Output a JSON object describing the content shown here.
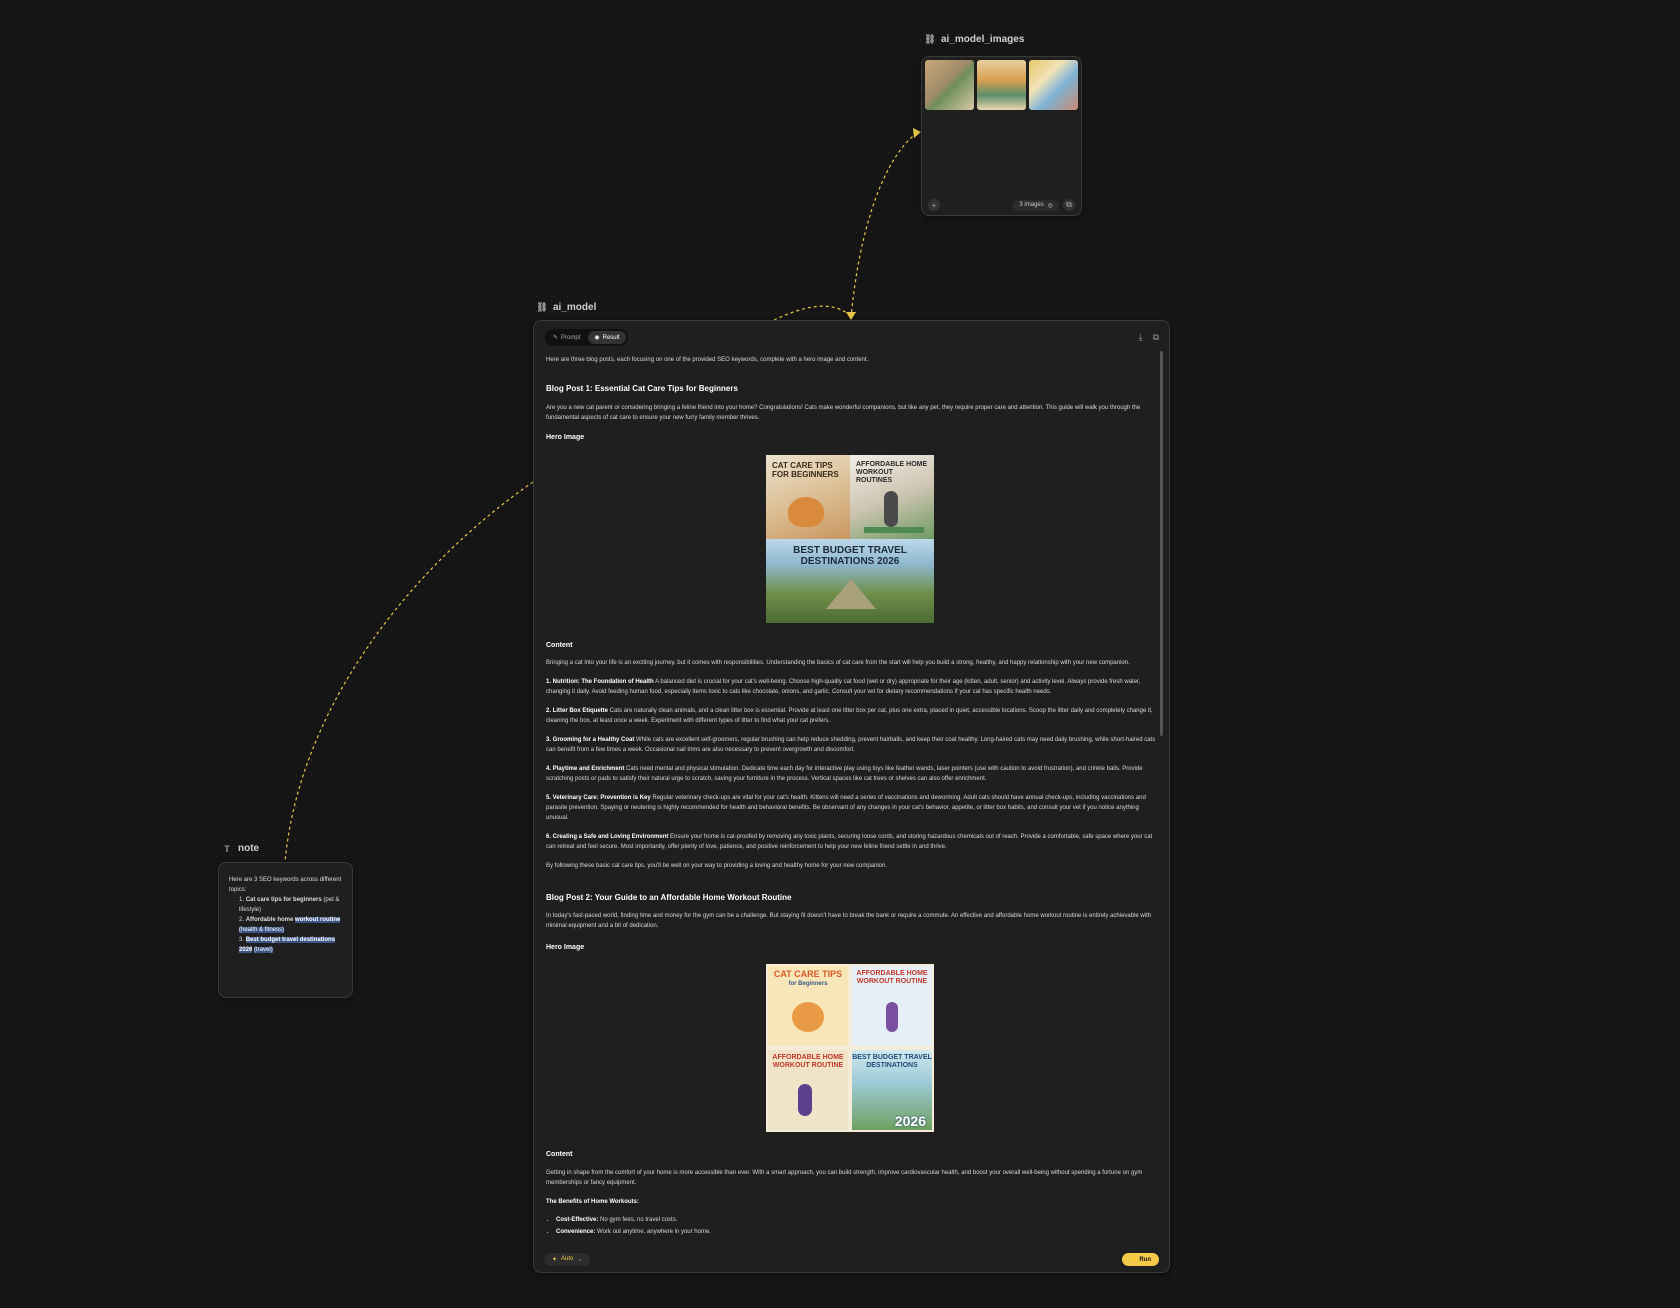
{
  "images_node": {
    "label": "ai_model_images",
    "count_label": "3 images",
    "thumbs": [
      {
        "name": "thumb-1",
        "colors": [
          "#c9a87a",
          "#6f8f5a",
          "#d9c7a8"
        ]
      },
      {
        "name": "thumb-2",
        "colors": [
          "#d9a050",
          "#5d8e6a",
          "#e9d6b0"
        ]
      },
      {
        "name": "thumb-3",
        "colors": [
          "#e8c86a",
          "#7db3d6",
          "#c98b6e"
        ]
      }
    ]
  },
  "main_node": {
    "label": "ai_model",
    "tabs": [
      {
        "label": "Prompt"
      },
      {
        "label": "Result"
      }
    ],
    "intro": "Here are three blog posts, each focusing on one of the provided SEO keywords, complete with a hero image and content.",
    "post1": {
      "title": "Blog Post 1: Essential Cat Care Tips for Beginners",
      "intro": "Are you a new cat parent or considering bringing a feline friend into your home? Congratulations! Cats make wonderful companions, but like any pet, they require proper care and attention. This guide will walk you through the fundamental aspects of cat care to ensure your new furry family member thrives.",
      "hero_label": "Hero Image",
      "image_texts": {
        "tl": "CAT CARE TIPS FOR BEGINNERS",
        "tr": "AFFORDABLE HOME WORKOUT ROUTINES",
        "bottom": "BEST BUDGET TRAVEL DESTINATIONS 2026"
      },
      "content_label": "Content",
      "content_intro": "Bringing a cat into your life is an exciting journey, but it comes with responsibilities. Understanding the basics of cat care from the start will help you build a strong, healthy, and happy relationship with your new companion.",
      "items": [
        {
          "title": "1. Nutrition: The Foundation of Health",
          "text": " A balanced diet is crucial for your cat's well-being. Choose high-quality cat food (wet or dry) appropriate for their age (kitten, adult, senior) and activity level. Always provide fresh water, changing it daily. Avoid feeding human food, especially items toxic to cats like chocolate, onions, and garlic. Consult your vet for dietary recommendations if your cat has specific health needs."
        },
        {
          "title": "2. Litter Box Etiquette",
          "text": " Cats are naturally clean animals, and a clean litter box is essential. Provide at least one litter box per cat, plus one extra, placed in quiet, accessible locations. Scoop the litter daily and completely change it, cleaning the box, at least once a week. Experiment with different types of litter to find what your cat prefers."
        },
        {
          "title": "3. Grooming for a Healthy Coat",
          "text": " While cats are excellent self-groomers, regular brushing can help reduce shedding, prevent hairballs, and keep their coat healthy. Long-haired cats may need daily brushing, while short-haired cats can benefit from a few times a week. Occasional nail trims are also necessary to prevent overgrowth and discomfort."
        },
        {
          "title": "4. Playtime and Enrichment",
          "text": " Cats need mental and physical stimulation. Dedicate time each day for interactive play using toys like feather wands, laser pointers (use with caution to avoid frustration), and crinkle balls. Provide scratching posts or pads to satisfy their natural urge to scratch, saving your furniture in the process. Vertical spaces like cat trees or shelves can also offer enrichment."
        },
        {
          "title": "5. Veterinary Care: Prevention is Key",
          "text": " Regular veterinary check-ups are vital for your cat's health. Kittens will need a series of vaccinations and deworming. Adult cats should have annual check-ups, including vaccinations and parasite prevention. Spaying or neutering is highly recommended for health and behavioral benefits. Be observant of any changes in your cat's behavior, appetite, or litter box habits, and consult your vet if you notice anything unusual."
        },
        {
          "title": "6. Creating a Safe and Loving Environment",
          "text": " Ensure your home is cat-proofed by removing any toxic plants, securing loose cords, and storing hazardous chemicals out of reach. Provide a comfortable, safe space where your cat can retreat and feel secure. Most importantly, offer plenty of love, patience, and positive reinforcement to help your new feline friend settle in and thrive."
        }
      ],
      "outro": "By following these basic cat care tips, you'll be well on your way to providing a loving and healthy home for your new companion."
    },
    "post2": {
      "title": "Blog Post 2: Your Guide to an Affordable Home Workout Routine",
      "intro": "In today's fast-paced world, finding time and money for the gym can be a challenge. But staying fit doesn't have to break the bank or require a commute. An effective and affordable home workout routine is entirely achievable with minimal equipment and a bit of dedication.",
      "hero_label": "Hero Image",
      "image_texts": {
        "tl": "CAT CARE TIPS",
        "tl_sub": "for Beginners",
        "tr": "AFFORDABLE HOME WORKOUT ROUTINE",
        "bl": "AFFORDABLE HOME WORKOUT ROUTINE",
        "br": "BEST BUDGET TRAVEL DESTINATIONS",
        "br_year": "2026"
      },
      "content_label": "Content",
      "content_intro": "Getting in shape from the comfort of your home is more accessible than ever. With a smart approach, you can build strength, improve cardiovascular health, and boost your overall well-being without spending a fortune on gym memberships or fancy equipment.",
      "benefits_title": "The Benefits of Home Workouts:",
      "benefits": [
        {
          "title": "Cost-Effective:",
          "text": " No gym fees, no travel costs."
        },
        {
          "title": "Convenience:",
          "text": " Work out anytime, anywhere in your home."
        }
      ]
    },
    "auto_label": "Auto",
    "run_label": "Run"
  },
  "note_node": {
    "label": "note",
    "intro": "Here are 3 SEO keywords across different topics:",
    "items": [
      {
        "num": "1.",
        "keyword": "Cat care tips for beginners",
        "tag": "(pet & lifestyle)"
      },
      {
        "num": "2.",
        "keyword_a": "Affordable home",
        "keyword_b": "workout routine",
        "tag": "(health & fitness)"
      },
      {
        "num": "3.",
        "keyword": "Best budget travel destinations 2026",
        "tag": "(travel)"
      }
    ]
  },
  "colors": {
    "accent": "#f3c94a",
    "edge": "#e6c74a",
    "highlight": "#3b5687",
    "canvas": "#151515"
  }
}
